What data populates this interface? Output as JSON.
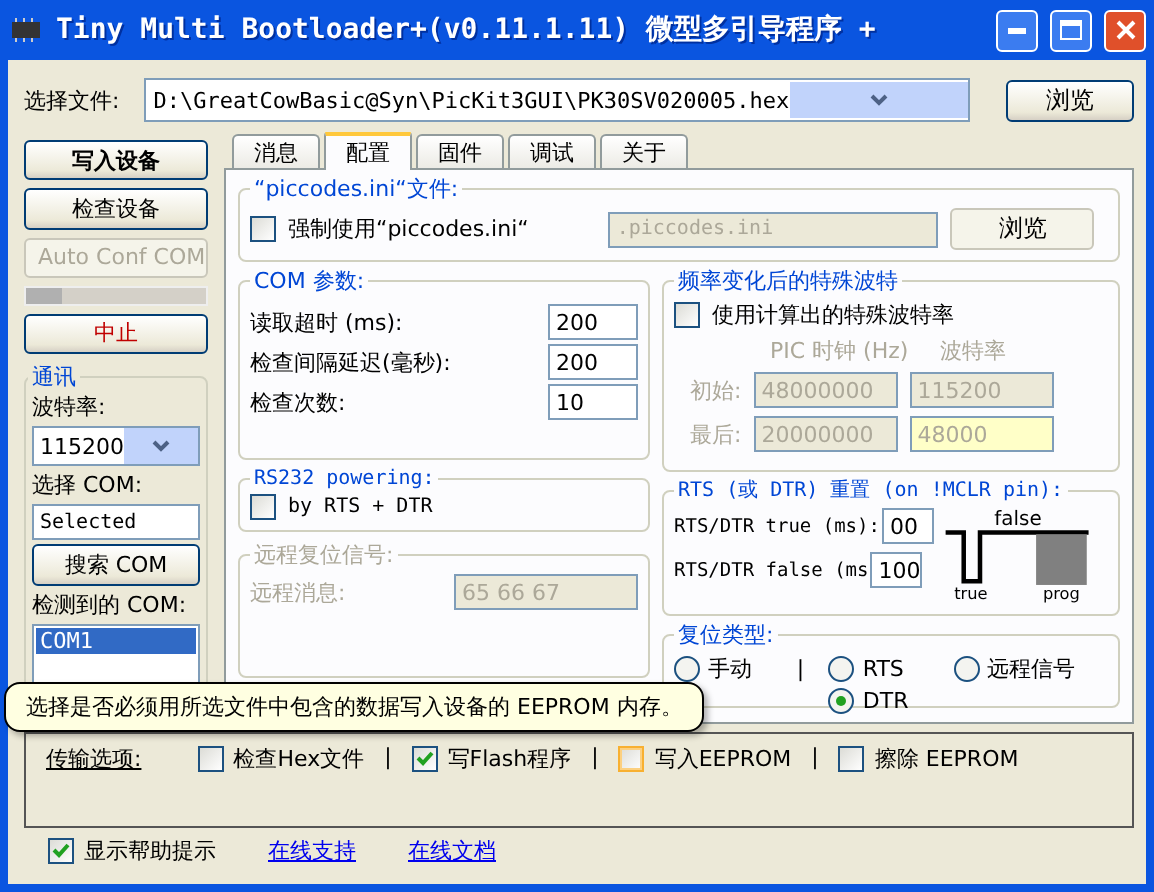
{
  "window": {
    "title": "Tiny Multi Bootloader+(v0.11.1.11) 微型多引导程序 +"
  },
  "file_select": {
    "label": "选择文件:",
    "value": "D:\\GreatCowBasic@Syn\\PicKit3GUI\\PK30SV020005.hex",
    "browse": "浏览"
  },
  "left_panel": {
    "buttons": [
      {
        "label": "写入设备",
        "disabled": false,
        "bold": true
      },
      {
        "label": "检查设备",
        "disabled": false,
        "bold": false
      },
      {
        "label": "Auto Conf COM",
        "disabled": true,
        "bold": false
      }
    ],
    "progress": {
      "level": 0.2
    },
    "stop": "中止",
    "comm": {
      "title": "通讯",
      "baud_label": "波特率:",
      "baud_value": "115200",
      "com_label": "选择 COM:",
      "com_value": "Selected",
      "search": "搜索 COM",
      "detected_label": "检测到的 COM:",
      "com_list": [
        {
          "label": "COM1",
          "selected": true
        }
      ]
    }
  },
  "tabs": [
    {
      "label": "消息",
      "selected": false
    },
    {
      "label": "配置",
      "selected": true
    },
    {
      "label": "固件",
      "selected": false
    },
    {
      "label": "调试",
      "selected": false
    },
    {
      "label": "关于",
      "selected": false
    }
  ],
  "config": {
    "piccodes": {
      "title": "“piccodes.ini“文件:",
      "checkbox": {
        "label": "强制使用“piccodes.ini“",
        "checked": false
      },
      "value": ".piccodes.ini",
      "browse": "浏览"
    },
    "com_params": {
      "title": "COM 参数:",
      "rows": [
        {
          "label": "读取超时 (ms):",
          "value": "200"
        },
        {
          "label": "检查间隔延迟(毫秒):",
          "value": "200"
        },
        {
          "label": "检查次数:",
          "value": "10"
        }
      ]
    },
    "rs232": {
      "title": "RS232 powering:",
      "checkbox": {
        "label": "by RTS + DTR",
        "checked": false
      }
    },
    "remote": {
      "title": "远程复位信号:",
      "message_label": "远程消息:",
      "message_value": "65 66 67"
    },
    "baud_change": {
      "title": "频率变化后的特殊波特",
      "checkbox": {
        "label": "使用计算出的特殊波特率",
        "checked": false
      },
      "headers": [
        "PIC 时钟 (Hz)",
        "波特率"
      ],
      "rows": [
        {
          "label": "初始:",
          "clock": "48000000",
          "baud": "115200",
          "highlight": false
        },
        {
          "label": "最后:",
          "clock": "20000000",
          "baud": "48000",
          "highlight": true
        }
      ]
    },
    "rts_reset": {
      "title": "RTS (或 DTR) 重置 (on !MCLR pin):",
      "rows": [
        {
          "label": "RTS/DTR true (ms):",
          "value": "00"
        },
        {
          "label": "RTS/DTR false (ms",
          "value": "100"
        }
      ],
      "diagram_labels": [
        "false",
        "true",
        "prog"
      ]
    },
    "reset_type": {
      "title": "复位类型:",
      "items": [
        {
          "kind": "radio",
          "label": "手动",
          "selected": false
        },
        {
          "kind": "separator",
          "label": "|"
        },
        {
          "kind": "radio",
          "label": "RTS",
          "selected": false
        },
        {
          "kind": "radio",
          "label": "远程信号",
          "selected": false
        },
        {
          "kind": "radio",
          "label": "DTR",
          "selected": true
        }
      ]
    }
  },
  "tooltip": "选择是否必须用所选文件中包含的数据写入设备的 EEPROM 内存。",
  "transfer": {
    "label": "传输选项:",
    "items": [
      {
        "kind": "checkbox",
        "label": "检查Hex文件",
        "checked": false,
        "hover": false
      },
      {
        "kind": "separator",
        "label": "|"
      },
      {
        "kind": "checkbox",
        "label": "写Flash程序",
        "checked": true,
        "hover": false
      },
      {
        "kind": "separator",
        "label": "|"
      },
      {
        "kind": "checkbox",
        "label": "写入EEPROM",
        "checked": false,
        "hover": true
      },
      {
        "kind": "separator",
        "label": "|"
      },
      {
        "kind": "checkbox",
        "label": "擦除 EEPROM",
        "checked": false,
        "hover": false
      }
    ]
  },
  "footer": {
    "help": {
      "label": "显示帮助提示",
      "checked": true
    },
    "links": [
      "在线支持",
      "在线文档"
    ]
  }
}
